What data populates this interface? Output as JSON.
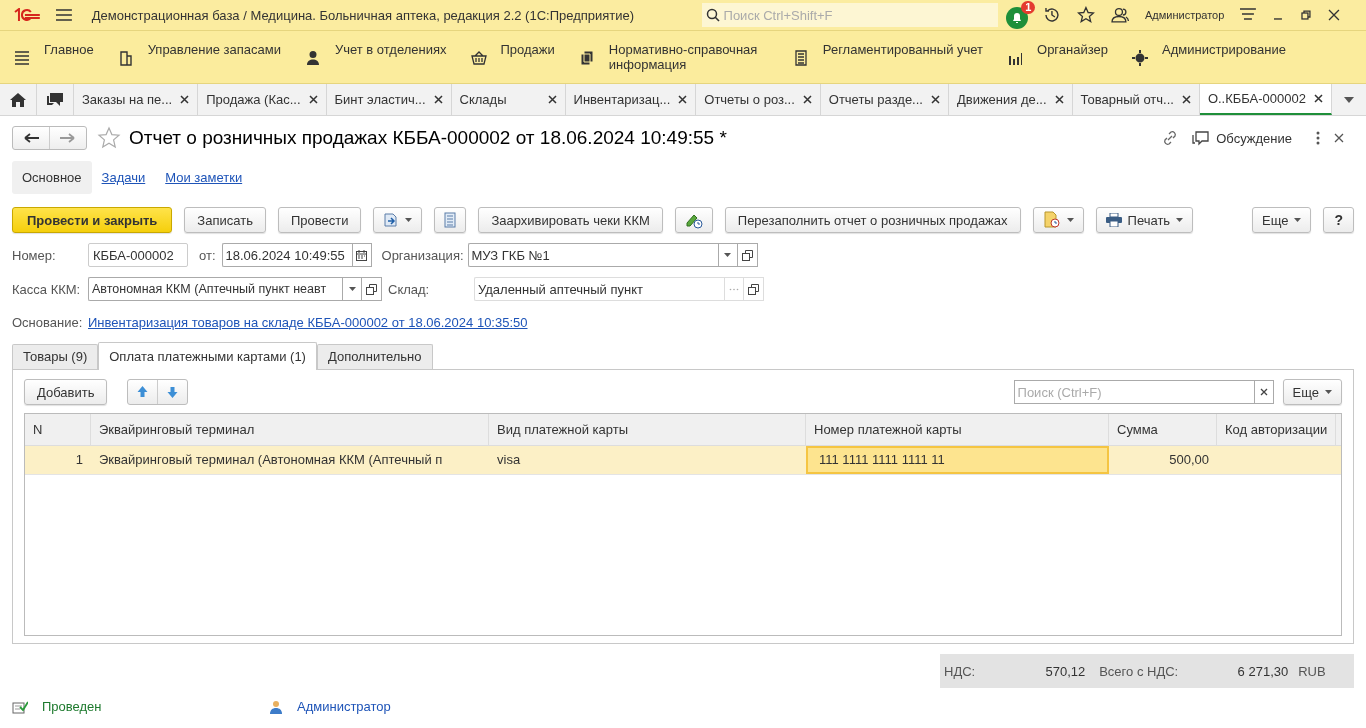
{
  "app_bar": {
    "title": "Демонстрационная база / Медицина. Больничная аптека, редакция 2.2  (1С:Предприятие)",
    "search": {
      "placeholder": "Поиск Ctrl+Shift+F"
    },
    "notifications": "1",
    "user": "Администратор"
  },
  "sections": [
    {
      "label": "Главное",
      "kind": "main"
    },
    {
      "label": "Управление запасами",
      "kind": "stock"
    },
    {
      "label": "Учет в отделениях",
      "kind": "dept"
    },
    {
      "label": "Продажи",
      "kind": "sales"
    },
    {
      "label": "Нормативно-справочная информация",
      "kind": "refs"
    },
    {
      "label": "Регламентированный учет",
      "kind": "reg"
    },
    {
      "label": "Органайзер",
      "kind": "org"
    },
    {
      "label": "Администрирование",
      "kind": "admin"
    }
  ],
  "open_tabs": [
    {
      "label": "Заказы на пе...",
      "selected": false
    },
    {
      "label": "Продажа (Кас...",
      "selected": false
    },
    {
      "label": "Бинт эластич...",
      "selected": false
    },
    {
      "label": "Склады",
      "selected": false
    },
    {
      "label": "Инвентаризац...",
      "selected": false
    },
    {
      "label": "Отчеты о роз...",
      "selected": false
    },
    {
      "label": "Отчеты разде...",
      "selected": false
    },
    {
      "label": "Движения де...",
      "selected": false
    },
    {
      "label": "Товарный отч...",
      "selected": false
    },
    {
      "label": "О..КББА-000002",
      "selected": true
    }
  ],
  "form": {
    "title": "Отчет о розничных продажах КББА-000002 от 18.06.2024 10:49:55 *",
    "discussion": "Обсуждение",
    "nav": [
      {
        "label": "Основное",
        "selected": true
      },
      {
        "label": "Задачи",
        "selected": false
      },
      {
        "label": "Мои заметки",
        "selected": false
      }
    ],
    "toolbar": [
      {
        "kind": "primary",
        "label": "Провести и закрыть"
      },
      {
        "kind": "plain",
        "label": "Записать"
      },
      {
        "kind": "plain",
        "label": "Провести"
      },
      {
        "kind": "based-on"
      },
      {
        "kind": "structure"
      },
      {
        "kind": "plain",
        "label": "Заархивировать чеки ККМ"
      },
      {
        "kind": "history"
      },
      {
        "kind": "plain",
        "label": "Перезаполнить отчет о розничных продажах"
      },
      {
        "kind": "reports"
      },
      {
        "kind": "print",
        "label": "Печать"
      },
      {
        "kind": "more",
        "label": "Еще"
      },
      {
        "kind": "help",
        "label": "?"
      }
    ],
    "number": {
      "label": "Номер:",
      "value": "КББА-000002"
    },
    "date": {
      "label": "от:",
      "value": "18.06.2024 10:49:55"
    },
    "organization": {
      "label": "Организация:",
      "value": "МУЗ ГКБ №1"
    },
    "register": {
      "label": "Касса ККМ:",
      "value": "Автономная ККМ (Аптечный пункт неавт"
    },
    "warehouse": {
      "label": "Склад:",
      "value": "Удаленный аптечный пункт"
    },
    "basis": {
      "label": "Основание:",
      "link": "Инвентаризация товаров на складе КББА-000002 от 18.06.2024 10:35:50"
    },
    "tabs": [
      {
        "label": "Товары (9)",
        "selected": false
      },
      {
        "label": "Оплата платежными картами (1)",
        "selected": true
      },
      {
        "label": "Дополнительно",
        "selected": false
      }
    ],
    "table": {
      "add": "Добавить",
      "search": {
        "placeholder": "Поиск (Ctrl+F)"
      },
      "more": "Еще",
      "columns": [
        "N",
        "Эквайринговый терминал",
        "Вид платежной карты",
        "Номер платежной карты",
        "Сумма",
        "Код авторизации"
      ],
      "rows": [
        {
          "selected": true,
          "cells": [
            {
              "text": "1",
              "focused": false
            },
            {
              "text": "Эквайринговый терминал (Автономная ККМ (Аптечный п",
              "focused": false
            },
            {
              "text": "visa",
              "focused": false
            },
            {
              "text": "111 1111 1111 1111 11",
              "focused": true
            },
            {
              "text": "500,00",
              "focused": false
            },
            {
              "focused": false
            }
          ]
        }
      ]
    },
    "totals": {
      "vat_label": "НДС:",
      "vat": "570,12",
      "total_label": "Всего с НДС:",
      "total": "6 271,30",
      "currency": "RUB"
    },
    "status": {
      "state": "Проведен",
      "author": "Администратор"
    }
  }
}
